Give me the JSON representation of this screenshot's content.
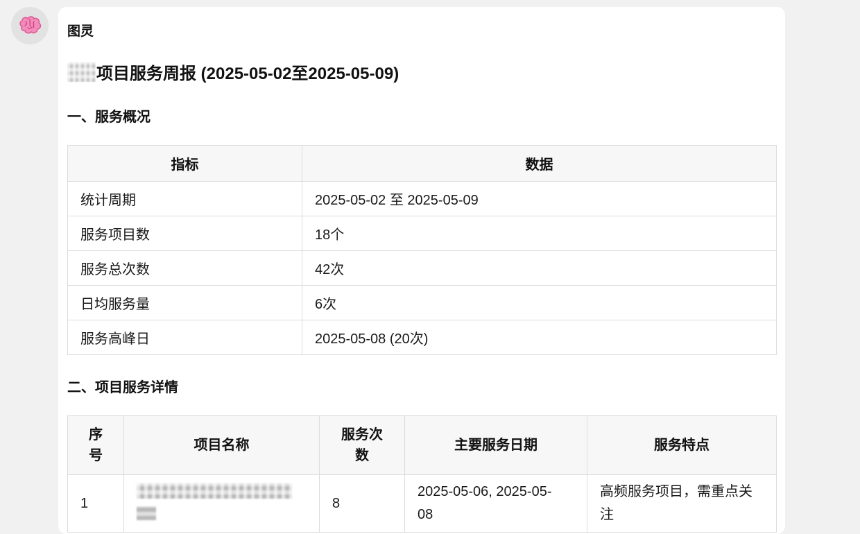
{
  "message": {
    "sender": "图灵",
    "avatar_icon": "brain-icon",
    "avatar_color": "#f06aa8",
    "title": "项目服务周报 (2025-05-02至2025-05-09)"
  },
  "section1": {
    "heading": "一、服务概况",
    "headers": [
      "指标",
      "数据"
    ],
    "rows": [
      {
        "metric": "统计周期",
        "value": "2025-05-02 至 2025-05-09"
      },
      {
        "metric": "服务项目数",
        "value": "18个"
      },
      {
        "metric": "服务总次数",
        "value": "42次"
      },
      {
        "metric": "日均服务量",
        "value": "6次"
      },
      {
        "metric": "服务高峰日",
        "value": "2025-05-08 (20次)"
      }
    ]
  },
  "section2": {
    "heading": "二、项目服务详情",
    "headers": {
      "index_line1": "序",
      "index_line2": "号",
      "name": "项目名称",
      "count_line1": "服务次",
      "count_line2": "数",
      "dates": "主要服务日期",
      "feature": "服务特点"
    },
    "rows": [
      {
        "index": "1",
        "count": "8",
        "dates_line1": "2025-05-06, 2025-05-",
        "dates_line2": "08",
        "feature_line1": "高频服务项目，需重点关",
        "feature_line2": "注"
      }
    ]
  }
}
